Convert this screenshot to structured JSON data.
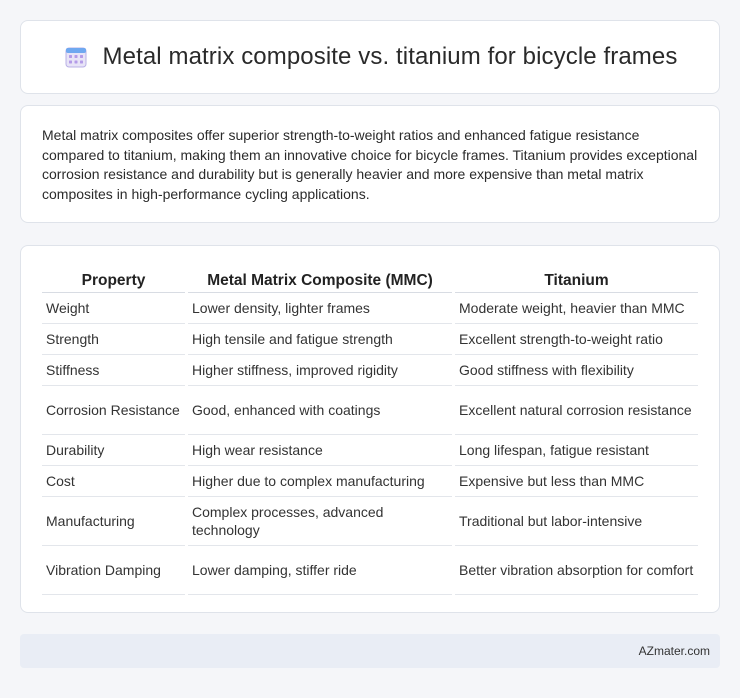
{
  "header": {
    "title": "Metal matrix composite vs. titanium for bicycle frames",
    "icon": "calendar-icon"
  },
  "summary": {
    "text": "Metal matrix composites offer superior strength-to-weight ratios and enhanced fatigue resistance compared to titanium, making them an innovative choice for bicycle frames. Titanium provides exceptional corrosion resistance and durability but is generally heavier and more expensive than metal matrix composites in high-performance cycling applications."
  },
  "table": {
    "headers": [
      "Property",
      "Metal Matrix Composite (MMC)",
      "Titanium"
    ],
    "rows": [
      [
        "Weight",
        "Lower density, lighter frames",
        "Moderate weight, heavier than MMC"
      ],
      [
        "Strength",
        "High tensile and fatigue strength",
        "Excellent strength-to-weight ratio"
      ],
      [
        "Stiffness",
        "Higher stiffness, improved rigidity",
        "Good stiffness with flexibility"
      ],
      [
        "Corrosion Resistance",
        "Good, enhanced with coatings",
        "Excellent natural corrosion resistance"
      ],
      [
        "Durability",
        "High wear resistance",
        "Long lifespan, fatigue resistant"
      ],
      [
        "Cost",
        "Higher due to complex manufacturing",
        "Expensive but less than MMC"
      ],
      [
        "Manufacturing",
        "Complex processes, advanced technology",
        "Traditional but labor-intensive"
      ],
      [
        "Vibration Damping",
        "Lower damping, stiffer ride",
        "Better vibration absorption for comfort"
      ]
    ]
  },
  "footer": {
    "brand": "AZmater.com"
  }
}
